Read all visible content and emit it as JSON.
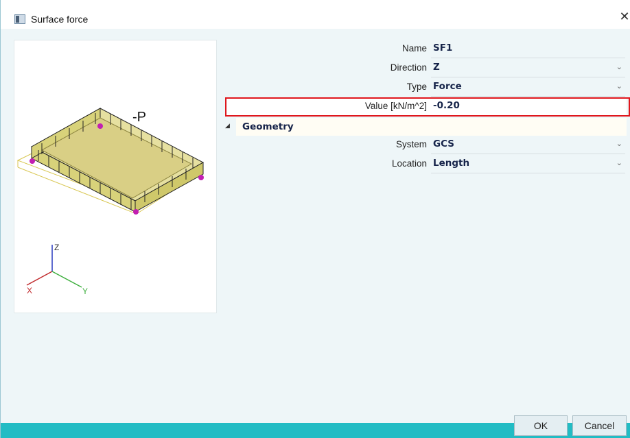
{
  "window": {
    "title": "Surface force",
    "close_glyph": "✕"
  },
  "preview": {
    "load_label": "-P",
    "axes": {
      "z": "Z",
      "x": "X",
      "y": "Y"
    },
    "colors": {
      "slab": "#d8d27a",
      "arrow": "#222222",
      "node": "#c21fb2",
      "axis_x": "#c0282b",
      "axis_y": "#3cae3c",
      "axis_z": "#2a3cc0"
    }
  },
  "properties": {
    "rows": [
      {
        "label": "Name",
        "value": "SF1",
        "dropdown": false
      },
      {
        "label": "Direction",
        "value": "Z",
        "dropdown": true
      },
      {
        "label": "Type",
        "value": "Force",
        "dropdown": true
      },
      {
        "label": "Value [kN/m^2]",
        "value": "-0.20",
        "dropdown": false,
        "highlighted": true
      }
    ],
    "geometry_section": {
      "label": "Geometry",
      "expanded": true
    },
    "geometry_rows": [
      {
        "label": "System",
        "value": "GCS",
        "dropdown": true
      },
      {
        "label": "Location",
        "value": "Length",
        "dropdown": true
      }
    ]
  },
  "buttons": {
    "ok": "OK",
    "cancel": "Cancel"
  },
  "icons": {
    "chevron": "chevron-down-icon",
    "collapse": "collapse-triangle-icon"
  },
  "theme": {
    "accent": "#22bcc4",
    "highlight_border": "#e0161c"
  }
}
